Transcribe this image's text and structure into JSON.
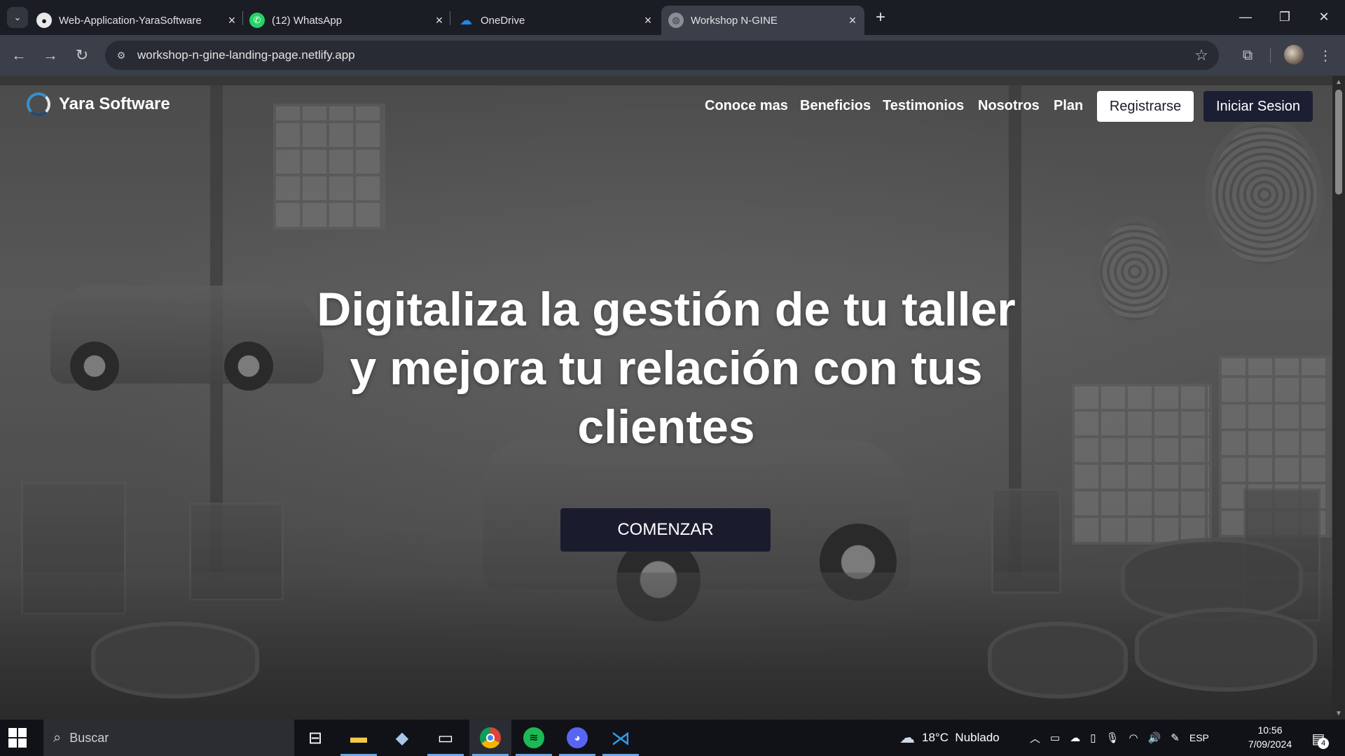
{
  "browser": {
    "tabs": [
      {
        "title": "Web-Application-YaraSoftware",
        "icon": "github-icon"
      },
      {
        "title": "(12) WhatsApp",
        "icon": "whatsapp-icon"
      },
      {
        "title": "OneDrive",
        "icon": "onedrive-icon"
      },
      {
        "title": "Workshop N-GINE",
        "icon": "globe-icon"
      }
    ],
    "url": "workshop-n-gine-landing-page.netlify.app"
  },
  "site": {
    "logo_text": "Yara Software",
    "nav": [
      "Conoce mas",
      "Beneficios",
      "Testimonios",
      "Nosotros",
      "Plan"
    ],
    "register_label": "Registrarse",
    "login_label": "Iniciar Sesion",
    "hero_lines": [
      "Digitaliza la gestión de tu taller",
      "y mejora tu relación con tus",
      "clientes"
    ],
    "cta_label": "COMENZAR"
  },
  "taskbar": {
    "search_placeholder": "Buscar",
    "weather": "18°C  Nublado",
    "language": "ESP",
    "time": "10:56",
    "date": "7/09/2024",
    "notification_count": "4"
  },
  "colors": {
    "accent_dark": "#1c1f33",
    "chrome_bg": "#1b1d25",
    "toolbar_bg": "#3b3f4a"
  }
}
